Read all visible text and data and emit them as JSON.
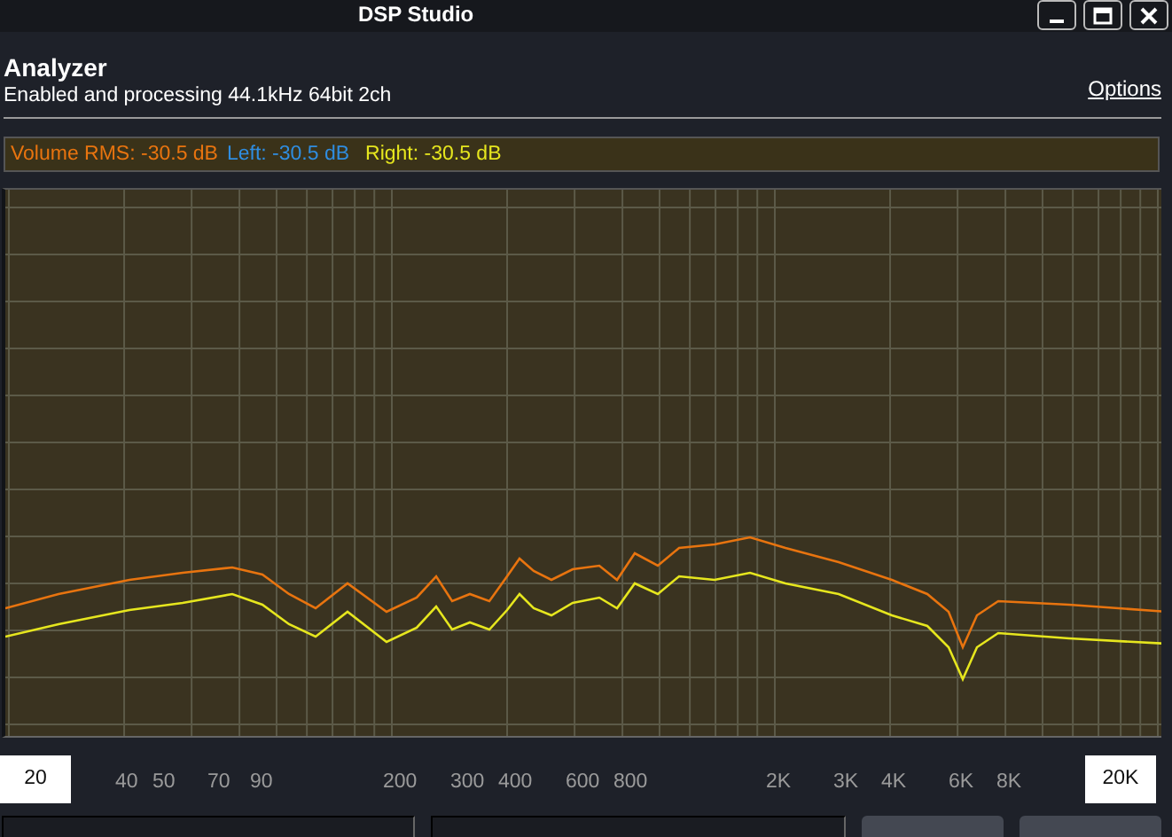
{
  "window": {
    "title": "DSP Studio"
  },
  "header": {
    "title": "Analyzer",
    "status": "Enabled and processing 44.1kHz 64bit 2ch",
    "options_link": "Options"
  },
  "levels": [
    {
      "text": "Volume RMS: -30.5 dB",
      "color": "#e8740f"
    },
    {
      "text": "Left: -30.5 dB",
      "color": "#2f8de0"
    },
    {
      "text": "Right: -30.5 dB",
      "color": "#e6e61e"
    }
  ],
  "frequency_labels": [
    {
      "label": "20",
      "boxed": true
    },
    {
      "label": "40",
      "boxed": false
    },
    {
      "label": "50",
      "boxed": false
    },
    {
      "label": "70",
      "boxed": false
    },
    {
      "label": "90",
      "boxed": false
    },
    {
      "label": "200",
      "boxed": false
    },
    {
      "label": "300",
      "boxed": false
    },
    {
      "label": "400",
      "boxed": false
    },
    {
      "label": "600",
      "boxed": false
    },
    {
      "label": "800",
      "boxed": false
    },
    {
      "label": "2K",
      "boxed": false
    },
    {
      "label": "3K",
      "boxed": false
    },
    {
      "label": "4K",
      "boxed": false
    },
    {
      "label": "6K",
      "boxed": false
    },
    {
      "label": "8K",
      "boxed": false
    },
    {
      "label": "20K",
      "boxed": true
    }
  ]
}
